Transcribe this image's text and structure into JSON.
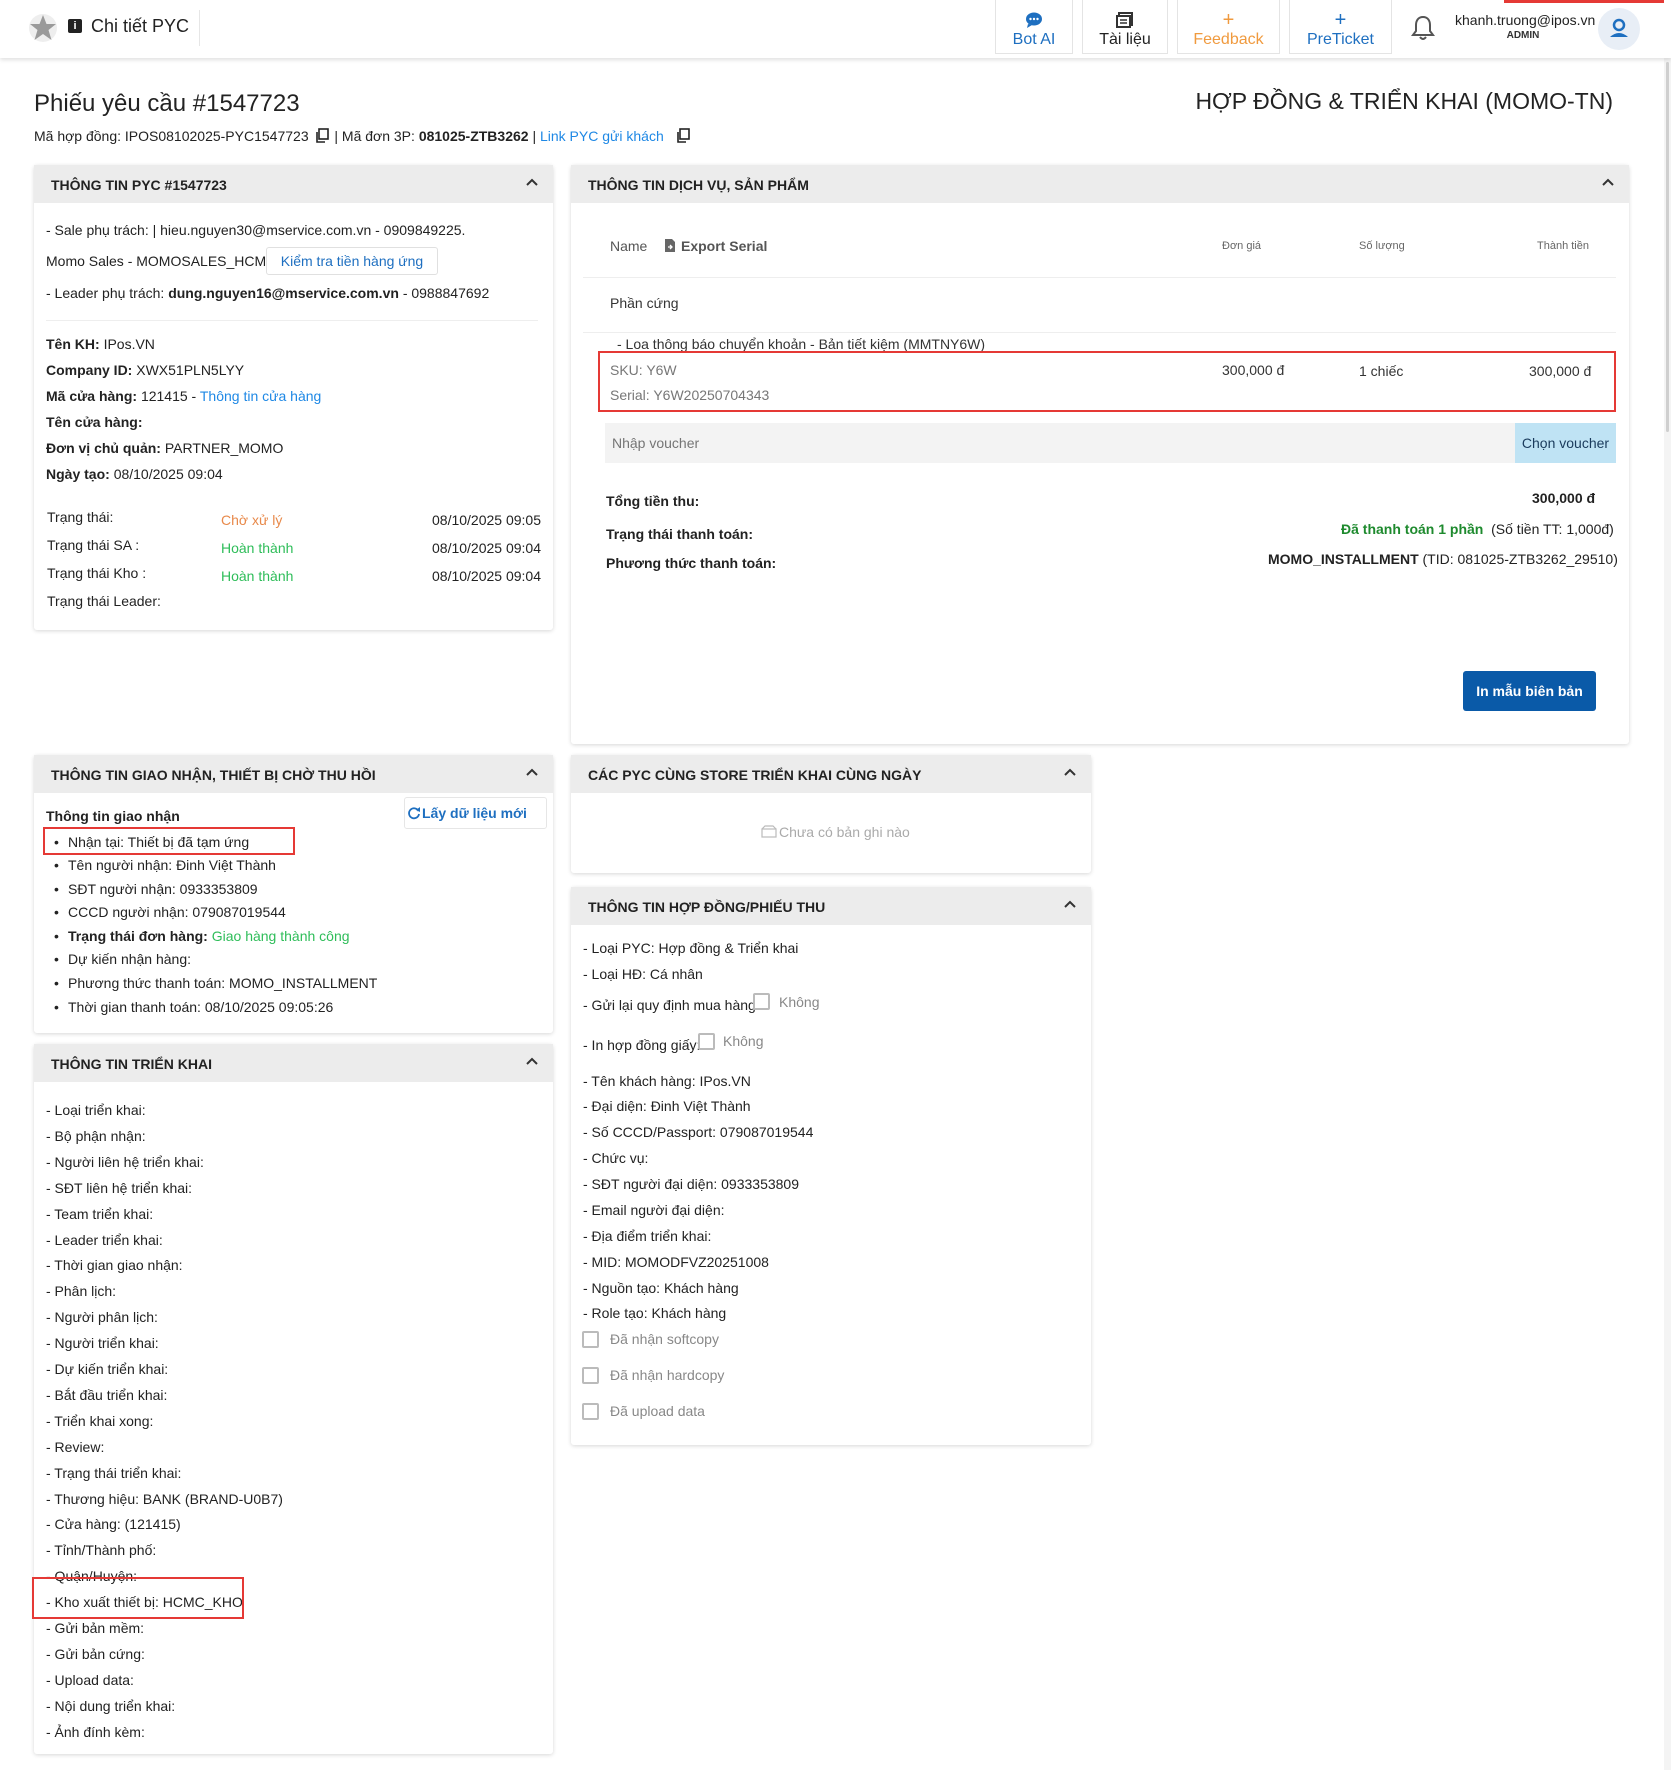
{
  "topbar": {
    "title": "Chi tiết PYC",
    "title_icon": "i",
    "nav": [
      {
        "label": "Bot AI",
        "icon": "💬",
        "color": "#1e6fc0"
      },
      {
        "label": "Tài liệu",
        "icon": "▤",
        "color": "#222222"
      },
      {
        "label": "Feedback",
        "icon": "+",
        "color": "#f09a3e"
      },
      {
        "label": "PreTicket",
        "icon": "+",
        "color": "#1e6fc0"
      }
    ],
    "user_email": "khanh.truong@ipos.vn",
    "user_role": "ADMIN"
  },
  "header": {
    "title": "Phiếu yêu cầu #1547723",
    "contract_type": "HỢP ĐỒNG & TRIỂN KHAI (MOMO-TN)",
    "contract_label": "Mã hợp đồng: IPOS08102025-PYC1547723",
    "order_label": "| Mã đơn 3P:",
    "order_code": "081025-ZTB3262",
    "sep": "|",
    "link_label": "Link PYC gửi khách"
  },
  "pyc_info": {
    "title": "THÔNG TIN PYC #1547723",
    "sale_line": "- Sale phụ trách: | hieu.nguyen30@mservice.com.vn - 0909849225.",
    "sales_team": "Momo Sales - MOMOSALES_HCM",
    "check_button": "Kiểm tra tiền hàng ứng",
    "leader_prefix": "- Leader phụ trách:",
    "leader_email": "dung.nguyen16@mservice.com.vn",
    "leader_phone": "- 0988847692",
    "fields": [
      {
        "label": "Tên KH:",
        "value": "IPos.VN"
      },
      {
        "label": "Company ID:",
        "value": "XWX51PLN5LYY"
      },
      {
        "label": "Mã cửa hàng:",
        "value": "121415 -"
      },
      {
        "label": "Tên cửa hàng:",
        "value": ""
      },
      {
        "label": "Đơn vị chủ quản:",
        "value": "PARTNER_MOMO"
      },
      {
        "label": "Ngày tạo:",
        "value": "08/10/2025 09:04"
      }
    ],
    "store_link": "Thông tin cửa hàng",
    "statuses": [
      {
        "label": "Trạng thái:",
        "value": "Chờ xử lý",
        "time": "08/10/2025 09:05"
      },
      {
        "label": "Trạng thái SA :",
        "value": "Hoàn thành",
        "time": "08/10/2025 09:04"
      },
      {
        "label": "Trạng thái Kho :",
        "value": "Hoàn thành",
        "time": "08/10/2025 09:04"
      },
      {
        "label": "Trạng thái Leader:",
        "value": "",
        "time": ""
      }
    ]
  },
  "service_info": {
    "title": "THÔNG TIN DỊCH VỤ, SẢN PHẨM",
    "col_name": "Name",
    "export_serial": "Export Serial",
    "col_price": "Đơn giá",
    "col_qty": "Số lượng",
    "col_total": "Thành tiền",
    "group": "Phần cứng",
    "product_name": "- Loa thông báo chuyển khoản - Bản tiết kiệm (MMTNY6W)",
    "sku": "SKU: Y6W",
    "serial": "Serial: Y6W20250704343",
    "price": "300,000 đ",
    "qty": "1 chiếc",
    "total": "300,000 đ",
    "voucher_placeholder": "Nhập voucher",
    "voucher_button": "Chọn voucher",
    "total_label": "Tổng tiền thu:",
    "total_value": "300,000 đ",
    "pay_status_label": "Trạng thái thanh toán:",
    "pay_status_value": "Đã thanh toán 1 phần",
    "pay_status_note": "(Số tiền TT: 1,000đ)",
    "pay_method_label": "Phương thức thanh toán:",
    "pay_method_value": "MOMO_INSTALLMENT",
    "pay_method_note": "(TID: 081025-ZTB3262_29510)",
    "print_button": "In mẫu biên bản"
  },
  "delivery": {
    "title": "THÔNG TIN GIAO NHẬN, THIẾT BỊ CHỜ THU HỒI",
    "subtitle": "Thông tin giao nhận",
    "refresh_button": "Lấy dữ liệu mới",
    "items": [
      "Nhận tại: Thiết bị đã tạm ứng",
      "Tên người nhận: Đinh Việt Thành",
      "SĐT người nhận: 0933353809",
      "CCCD người nhận: 079087019544"
    ],
    "status_label": "Trạng thái đơn hàng:",
    "status_value": "Giao hàng thành công",
    "items2": [
      "Dự kiến nhận hàng:",
      "Phương thức thanh toán: MOMO_INSTALLMENT",
      "Thời gian thanh toán: 08/10/2025 09:05:26"
    ]
  },
  "same_store": {
    "title": "CÁC PYC CÙNG STORE TRIỂN KHAI CÙNG NGÀY",
    "empty": "Chưa có bản ghi nào"
  },
  "deployment": {
    "title": "THÔNG TIN TRIỂN KHAI",
    "lines": [
      "- Loại triển khai:",
      "- Bộ phận nhận:",
      "- Người liên hệ triển khai:",
      "- SĐT liên hệ triển khai:",
      "- Team triển khai:",
      "- Leader triển khai:",
      "- Thời gian giao nhận:",
      "- Phân lịch:",
      "- Người phân lịch:",
      "- Người triển khai:",
      "- Dự kiến triển khai:",
      "- Bắt đầu triển khai:",
      "- Triển khai xong:",
      "- Review:",
      "- Trạng thái triển khai:",
      "- Thương hiệu: BANK (BRAND-U0B7)",
      "- Cửa hàng: (121415)",
      "- Tỉnh/Thành phố:",
      "- Quận/Huyện:",
      "- Kho xuất thiết bị: HCMC_KHO",
      "- Gửi bản mềm:",
      "- Gửi bản cứng:",
      "- Upload data:",
      "- Nội dung triển khai:",
      "- Ảnh đính kèm:"
    ]
  },
  "contract": {
    "title": "THÔNG TIN HỢP ĐỒNG/PHIẾU THU",
    "lines_top": [
      "- Loại PYC: Hợp đồng & Triển khai",
      "- Loại HĐ: Cá nhân"
    ],
    "resend_label": "- Gửi lại quy định mua hàng:",
    "resend_value": "Không",
    "print_label": "- In hợp đồng giấy:",
    "print_value": "Không",
    "lines": [
      "- Tên khách hàng: IPos.VN",
      "- Đại diện: Đinh Việt Thành",
      "- Số CCCD/Passport: 079087019544",
      "- Chức vụ:",
      "- SĐT người đại diện: 0933353809",
      "- Email người đại diện:",
      "- Địa điểm triển khai:",
      "- MID: MOMODFVZ20251008",
      "- Nguồn tạo: Khách hàng",
      "- Role tạo: Khách hàng"
    ],
    "checks": [
      "Đã nhận softcopy",
      "Đã nhận hardcopy",
      "Đã upload data"
    ]
  }
}
